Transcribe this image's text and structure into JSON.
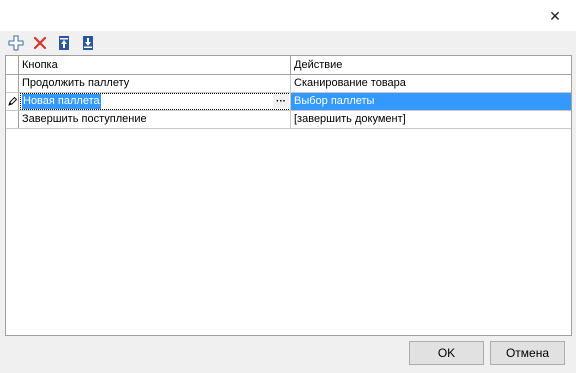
{
  "window": {
    "close_glyph": "✕"
  },
  "toolbar": {
    "items": [
      {
        "name": "add-icon",
        "tooltip": ""
      },
      {
        "name": "delete-icon",
        "tooltip": ""
      },
      {
        "name": "move-up-icon",
        "tooltip": ""
      },
      {
        "name": "move-down-icon",
        "tooltip": ""
      }
    ]
  },
  "grid": {
    "headers": {
      "button": "Кнопка",
      "action": "Действие"
    },
    "rows": [
      {
        "button": "Продолжить паллету",
        "action": "Сканирование товара"
      },
      {
        "button": "Новая паллета",
        "action": "Выбор паллеты"
      },
      {
        "button": "Завершить поступление",
        "action": "[завершить документ]"
      }
    ],
    "editing_row": 1,
    "ellipsis": "···",
    "selection_color": "#3399ff"
  },
  "footer": {
    "ok_label": "OK",
    "cancel_label": "Отмена"
  }
}
